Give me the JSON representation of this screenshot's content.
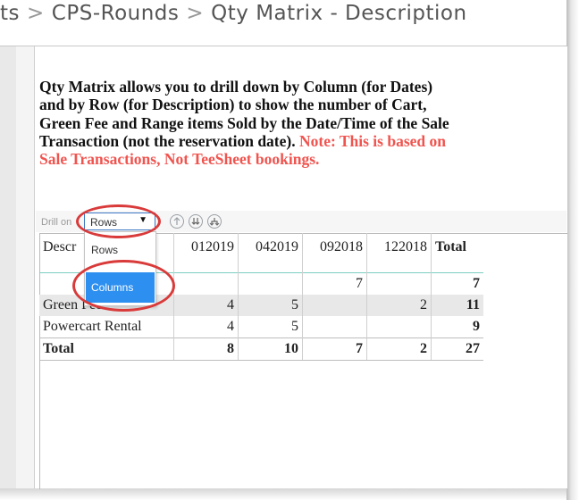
{
  "breadcrumb": {
    "items": [
      "ts",
      "CPS-Rounds",
      "Qty Matrix - Description"
    ],
    "separator": ">"
  },
  "description": {
    "main": "Qty Matrix allows you to drill down by Column (for Dates) and by Row (for Description) to show the number of Cart, Green Fee and Range items Sold by the Date/Time of the Sale Transaction (not the reservation date).",
    "note": "Note: This is based on Sale Transactions, Not TeeSheet bookings."
  },
  "toolbar": {
    "drill_label": "Drill on",
    "drill_value": "Rows",
    "drill_options": [
      "Rows",
      "Columns"
    ],
    "buttons": [
      "drill-up-icon",
      "drill-down-all-icon",
      "expand-hierarchy-icon"
    ]
  },
  "table": {
    "header_desc": "Descr",
    "columns": [
      "012019",
      "042019",
      "092018",
      "122018"
    ],
    "total_label": "Total",
    "rows": [
      {
        "label": "",
        "values": [
          "",
          "",
          "7",
          ""
        ],
        "total": "7"
      },
      {
        "label": "Green Fee",
        "values": [
          "4",
          "5",
          "",
          "2"
        ],
        "total": "11"
      },
      {
        "label": "Powercart Rental",
        "values": [
          "4",
          "5",
          "",
          ""
        ],
        "total": "9"
      }
    ],
    "totals": {
      "label": "Total",
      "values": [
        "8",
        "10",
        "7",
        "2"
      ],
      "total": "27"
    }
  },
  "colors": {
    "note_red": "#f0544f",
    "annotation_red": "#d93a3a",
    "selected_blue": "#2d8fef",
    "teal_divider": "#7ccfc0"
  }
}
